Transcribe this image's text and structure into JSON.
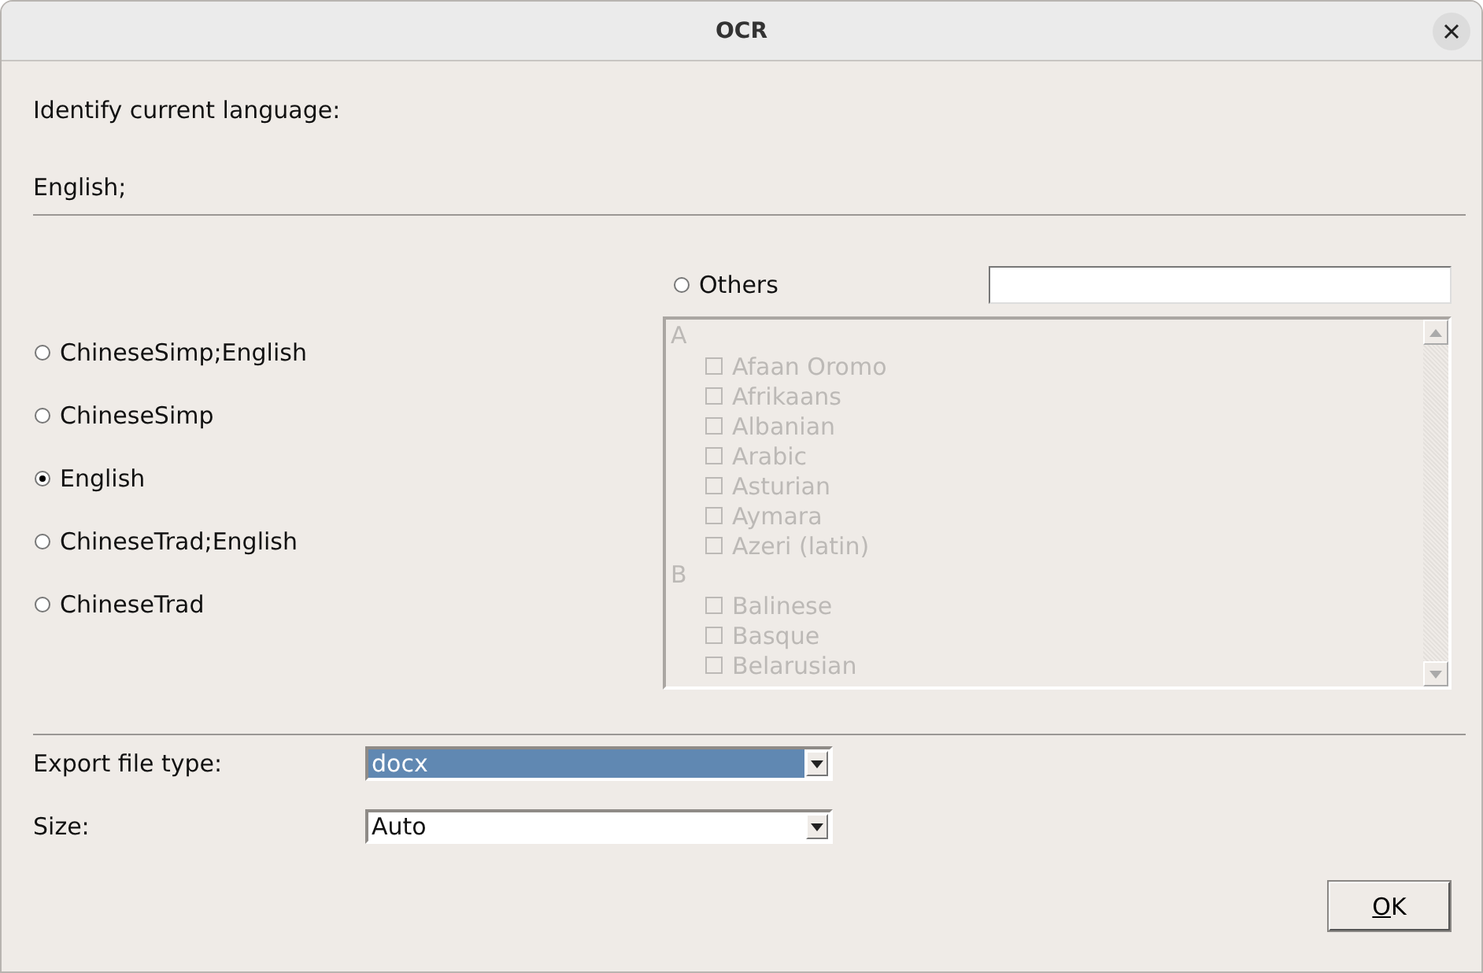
{
  "window": {
    "title": "OCR"
  },
  "prompt": "Identify current language:",
  "current_language": "English;",
  "presets": [
    {
      "label": "ChineseSimp;English",
      "selected": false
    },
    {
      "label": "ChineseSimp",
      "selected": false
    },
    {
      "label": "English",
      "selected": true
    },
    {
      "label": "ChineseTrad;English",
      "selected": false
    },
    {
      "label": "ChineseTrad",
      "selected": false
    }
  ],
  "others": {
    "label": "Others",
    "selected": false
  },
  "language_list": {
    "disabled": true,
    "groups": [
      {
        "letter": "A",
        "items": [
          {
            "label": "Afaan Oromo",
            "checked": false
          },
          {
            "label": "Afrikaans",
            "checked": false
          },
          {
            "label": "Albanian",
            "checked": false
          },
          {
            "label": "Arabic",
            "checked": false
          },
          {
            "label": "Asturian",
            "checked": false
          },
          {
            "label": "Aymara",
            "checked": false
          },
          {
            "label": "Azeri (latin)",
            "checked": false
          }
        ]
      },
      {
        "letter": "B",
        "items": [
          {
            "label": "Balinese",
            "checked": false
          },
          {
            "label": "Basque",
            "checked": false
          },
          {
            "label": "Belarusian",
            "checked": false
          }
        ]
      }
    ]
  },
  "fields": [
    {
      "label": "Export file type:",
      "value": "docx",
      "focused": true
    },
    {
      "label": "Size:",
      "value": "Auto",
      "focused": false
    }
  ],
  "buttons": [
    {
      "label": "OK"
    }
  ]
}
